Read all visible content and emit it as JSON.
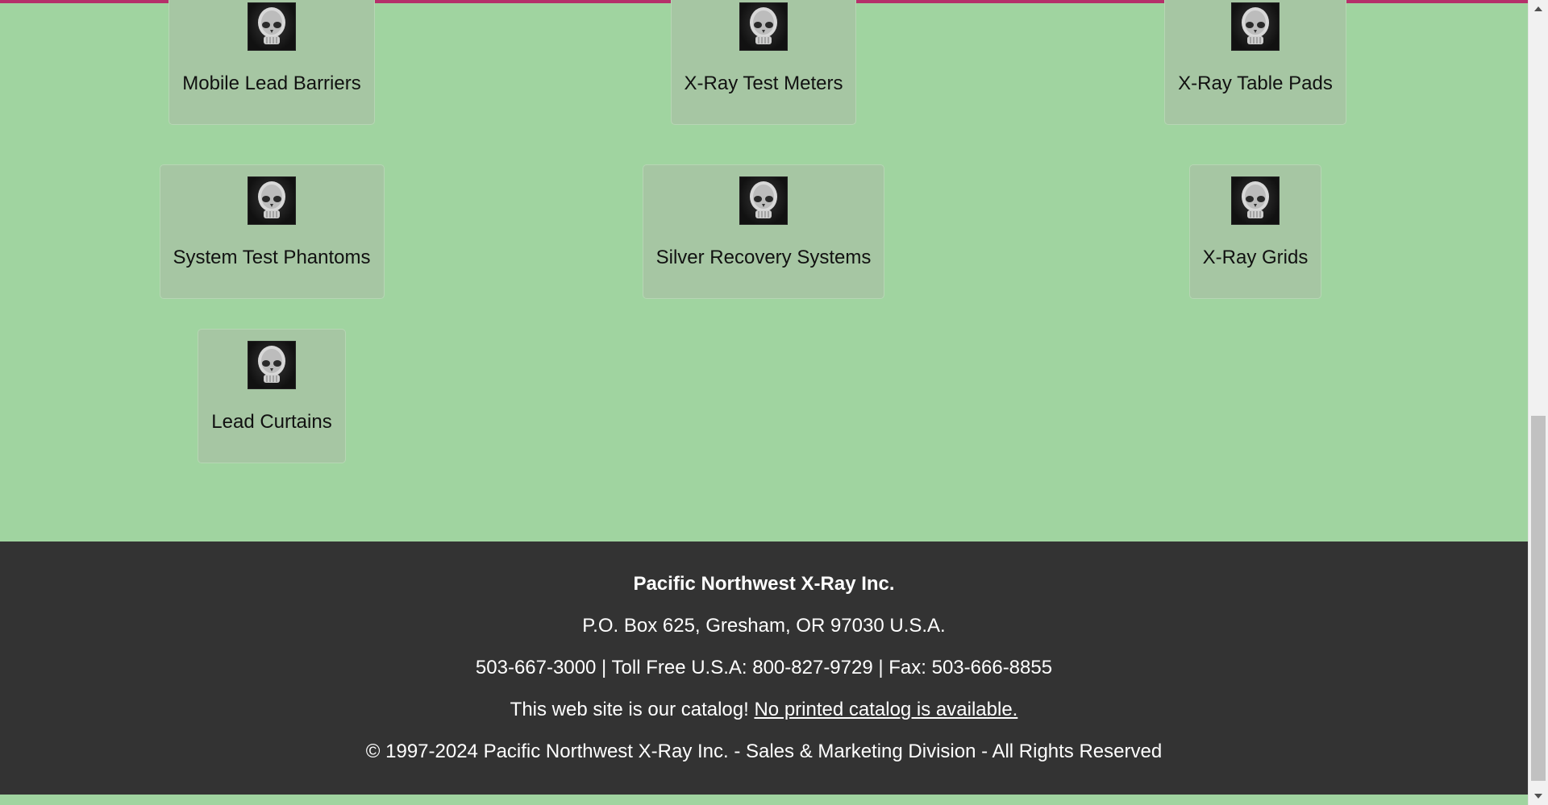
{
  "colors": {
    "page_background": "#a0d4a0",
    "tile_background": "#a6c6a3",
    "footer_background": "#333333",
    "footer_text": "#ffffff",
    "top_accent": "#b5306a"
  },
  "categories": [
    {
      "label": "Mobile Lead Barriers",
      "icon": "skull-xray-icon"
    },
    {
      "label": "X-Ray Test Meters",
      "icon": "skull-xray-icon"
    },
    {
      "label": "X-Ray Table Pads",
      "icon": "skull-xray-icon"
    },
    {
      "label": "System Test Phantoms",
      "icon": "skull-xray-icon"
    },
    {
      "label": "Silver Recovery Systems",
      "icon": "skull-xray-icon"
    },
    {
      "label": "X-Ray Grids",
      "icon": "skull-xray-icon"
    },
    {
      "label": "Lead Curtains",
      "icon": "skull-xray-icon"
    }
  ],
  "footer": {
    "company": "Pacific Northwest X-Ray Inc.",
    "address": "P.O. Box 625, Gresham, OR 97030 U.S.A.",
    "phones": "503-667-3000 | Toll Free U.S.A: 800-827-9729 | Fax: 503-666-8855",
    "catalog_text": "This web site is our catalog! ",
    "catalog_link": "No printed catalog is available.",
    "copyright": "© 1997-2024 Pacific Northwest X-Ray Inc. - Sales & Marketing Division - All Rights Reserved"
  },
  "scrollbar": {
    "up_icon": "arrow-up-icon",
    "down_icon": "arrow-down-icon"
  }
}
